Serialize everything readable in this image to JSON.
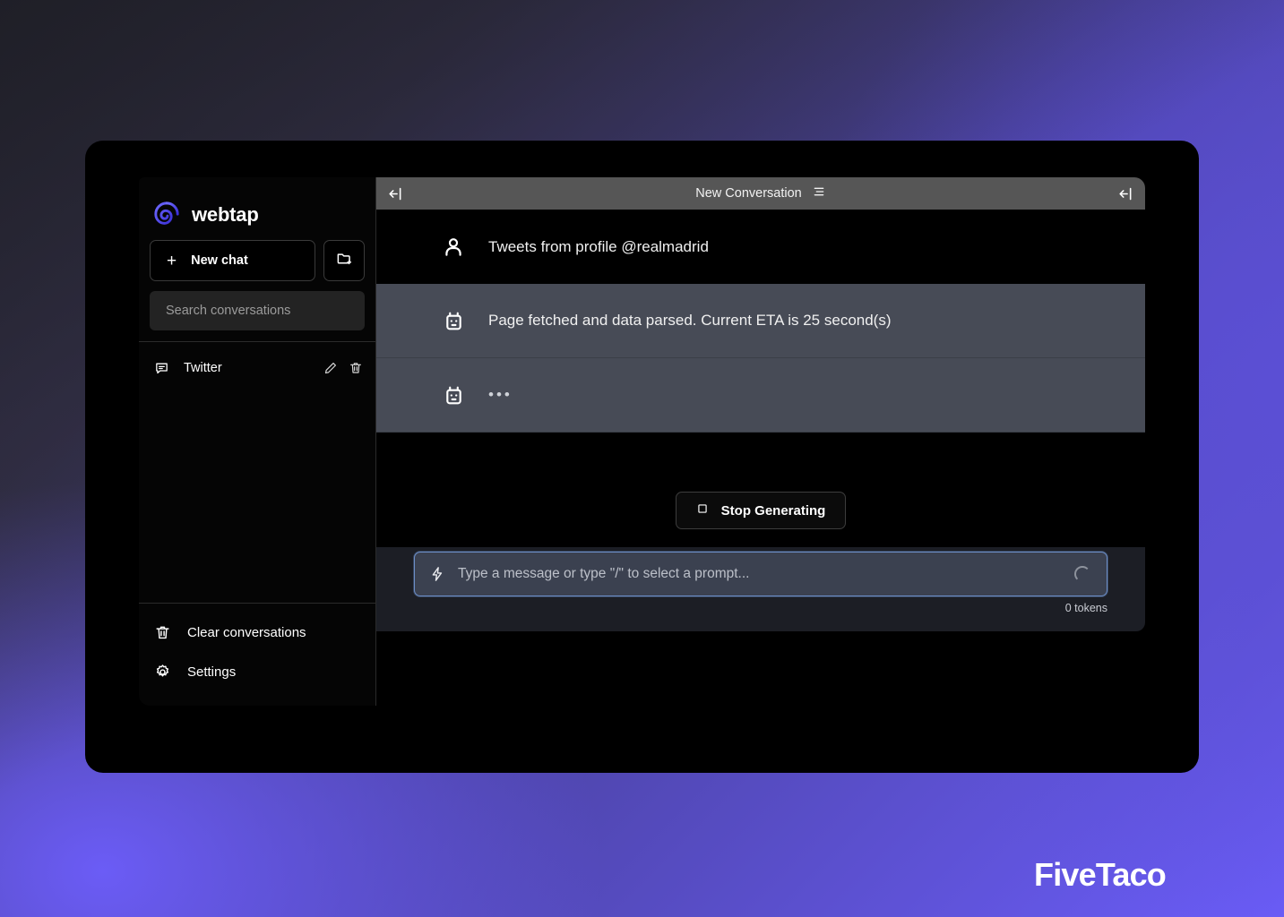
{
  "brand": {
    "name": "webtap",
    "logo_icon": "spiral-logo-icon",
    "accent": "#5b4ff0"
  },
  "sidebar": {
    "new_chat_label": "New chat",
    "new_chat_icon": "plus-icon",
    "new_folder_icon": "folder-plus-icon",
    "search": {
      "placeholder": "Search conversations",
      "value": "",
      "icon": "search-input"
    },
    "conversations": [
      {
        "label": "Twitter",
        "icon": "chat-bubble-icon",
        "edit_icon": "pencil-icon",
        "delete_icon": "trash-icon"
      }
    ],
    "footer": [
      {
        "label": "Clear conversations",
        "icon": "trash-icon"
      },
      {
        "label": "Settings",
        "icon": "gear-icon"
      }
    ]
  },
  "chat": {
    "header": {
      "title": "New Conversation",
      "title_icon": "list-settings-icon",
      "left_collapse_icon": "collapse-left-icon",
      "right_collapse_icon": "collapse-right-icon"
    },
    "messages": [
      {
        "role": "user",
        "avatar_icon": "user-icon",
        "text": "Tweets from profile @realmadrid"
      },
      {
        "role": "assistant",
        "avatar_icon": "robot-icon",
        "text": "Page fetched and data parsed. Current ETA is 25 second(s)"
      },
      {
        "role": "assistant",
        "avatar_icon": "robot-icon",
        "text": "•••"
      }
    ],
    "stop_button": {
      "label": "Stop Generating",
      "icon": "stop-square-icon"
    },
    "composer": {
      "placeholder": "Type a message or type \"/\" to select a prompt...",
      "value": "",
      "prefix_icon": "lightning-bolt-icon",
      "loading_icon": "spinner-icon",
      "token_count": "0 tokens"
    }
  },
  "watermark": {
    "text": "FiveTaco"
  }
}
